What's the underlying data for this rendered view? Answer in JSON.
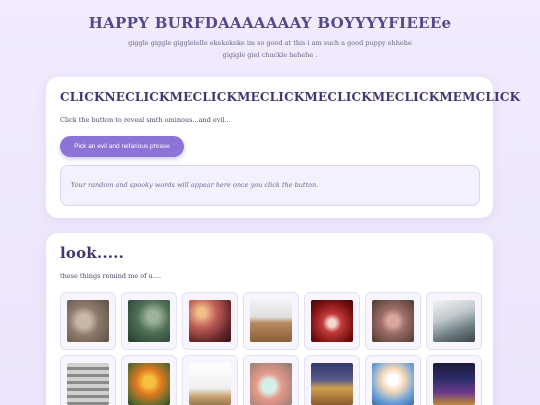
{
  "header": {
    "title": "HAPPY BURFDAAAAAAAY BOYYYYFIEEEe",
    "subtitle": "giggle giggle gigglelelle ekekekeke im so good at this i am such a good puppy ehhehe gigigle giel chuckle hehehe ."
  },
  "phrase_card": {
    "title": "CLICKNECLICKMECLICKMECLICKMECLICKMECLICKMEMCLICK",
    "description": "Click the button to reveal smth ominous...and evil...",
    "button_label": "Pick an evil and nefarious phrase",
    "output_text": "Your random and spooky words will appear here once you click the button."
  },
  "gallery_card": {
    "title": "look.....",
    "description": "these things remind me of u....",
    "thumbnails": [
      "t0",
      "t1",
      "t2",
      "t3",
      "t4",
      "t5",
      "t6",
      "t7",
      "t8",
      "t9",
      "t10",
      "t11",
      "t12",
      "t13"
    ]
  }
}
